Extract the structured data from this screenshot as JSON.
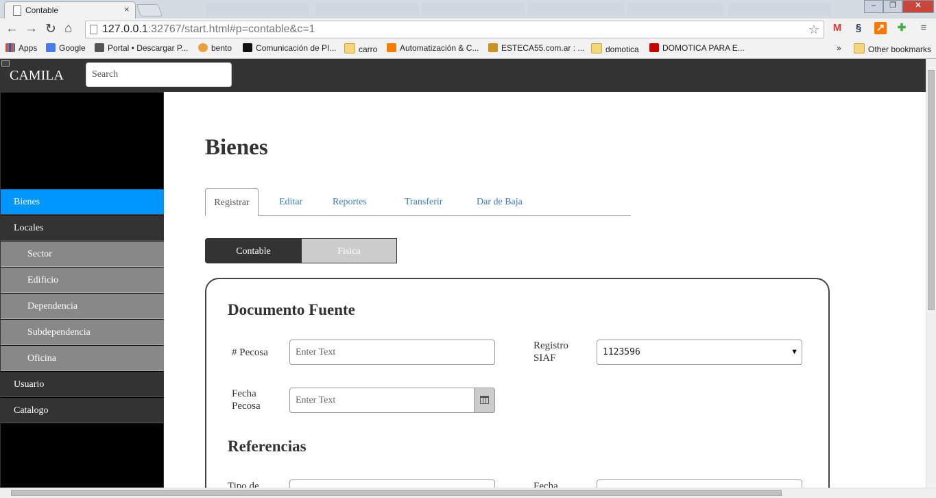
{
  "browser": {
    "tab_title": "Contable",
    "tab_close": "×",
    "url_host": "127.0.0.1",
    "url_rest": ":32767/start.html#p=contable&c=1",
    "bookmarks": [
      {
        "label": "Apps",
        "icon": "apps-grid-icon"
      },
      {
        "label": "Google",
        "icon": "google-icon"
      },
      {
        "label": "Portal • Descargar P...",
        "icon": "portal-icon"
      },
      {
        "label": "bento",
        "icon": "bento-icon"
      },
      {
        "label": "Comunicación de PI...",
        "icon": "chip-icon"
      },
      {
        "label": "carro",
        "icon": "folder-icon"
      },
      {
        "label": "Automatización & C...",
        "icon": "blogger-icon"
      },
      {
        "label": "ESTECA55.com.ar : ...",
        "icon": "esteca-icon"
      },
      {
        "label": "domotica",
        "icon": "folder-icon"
      },
      {
        "label": "DOMOTICA PARA E...",
        "icon": "youtube-icon"
      }
    ],
    "more": "»",
    "other_bookmarks": "Other bookmarks"
  },
  "app": {
    "brand": "CAMILA",
    "search_placeholder": "Search"
  },
  "sidebar": {
    "items": [
      {
        "label": "Bienes",
        "kind": "active"
      },
      {
        "label": "Locales",
        "kind": "main"
      },
      {
        "label": "Sector",
        "kind": "sub"
      },
      {
        "label": "Edificio",
        "kind": "sub"
      },
      {
        "label": "Dependencia",
        "kind": "sub"
      },
      {
        "label": "Subdependencia",
        "kind": "sub"
      },
      {
        "label": "Oficina",
        "kind": "sub"
      },
      {
        "label": "Usuario",
        "kind": "main"
      },
      {
        "label": "Catalogo",
        "kind": "main"
      }
    ]
  },
  "main": {
    "title": "Bienes",
    "tabs": [
      "Registrar",
      "Editar",
      "Reportes",
      "Transferir",
      "Dar de Baja"
    ],
    "segments": [
      "Contable",
      "Fisica"
    ],
    "section1": "Documento Fuente",
    "pecosa_label": "# Pecosa",
    "pecosa_placeholder": "Enter Text",
    "siaf_label_1": "Registro",
    "siaf_label_2": "SIAF",
    "siaf_value": "1123596",
    "fecha_label_1": "Fecha",
    "fecha_label_2": "Pecosa",
    "fecha_placeholder": "Enter Text",
    "section2": "Referencias",
    "tipo_label": "Tipo de",
    "fecha2_label": "Fecha"
  },
  "colors": {
    "active": "#0096ff",
    "dark": "#333333",
    "sub": "#888888"
  }
}
